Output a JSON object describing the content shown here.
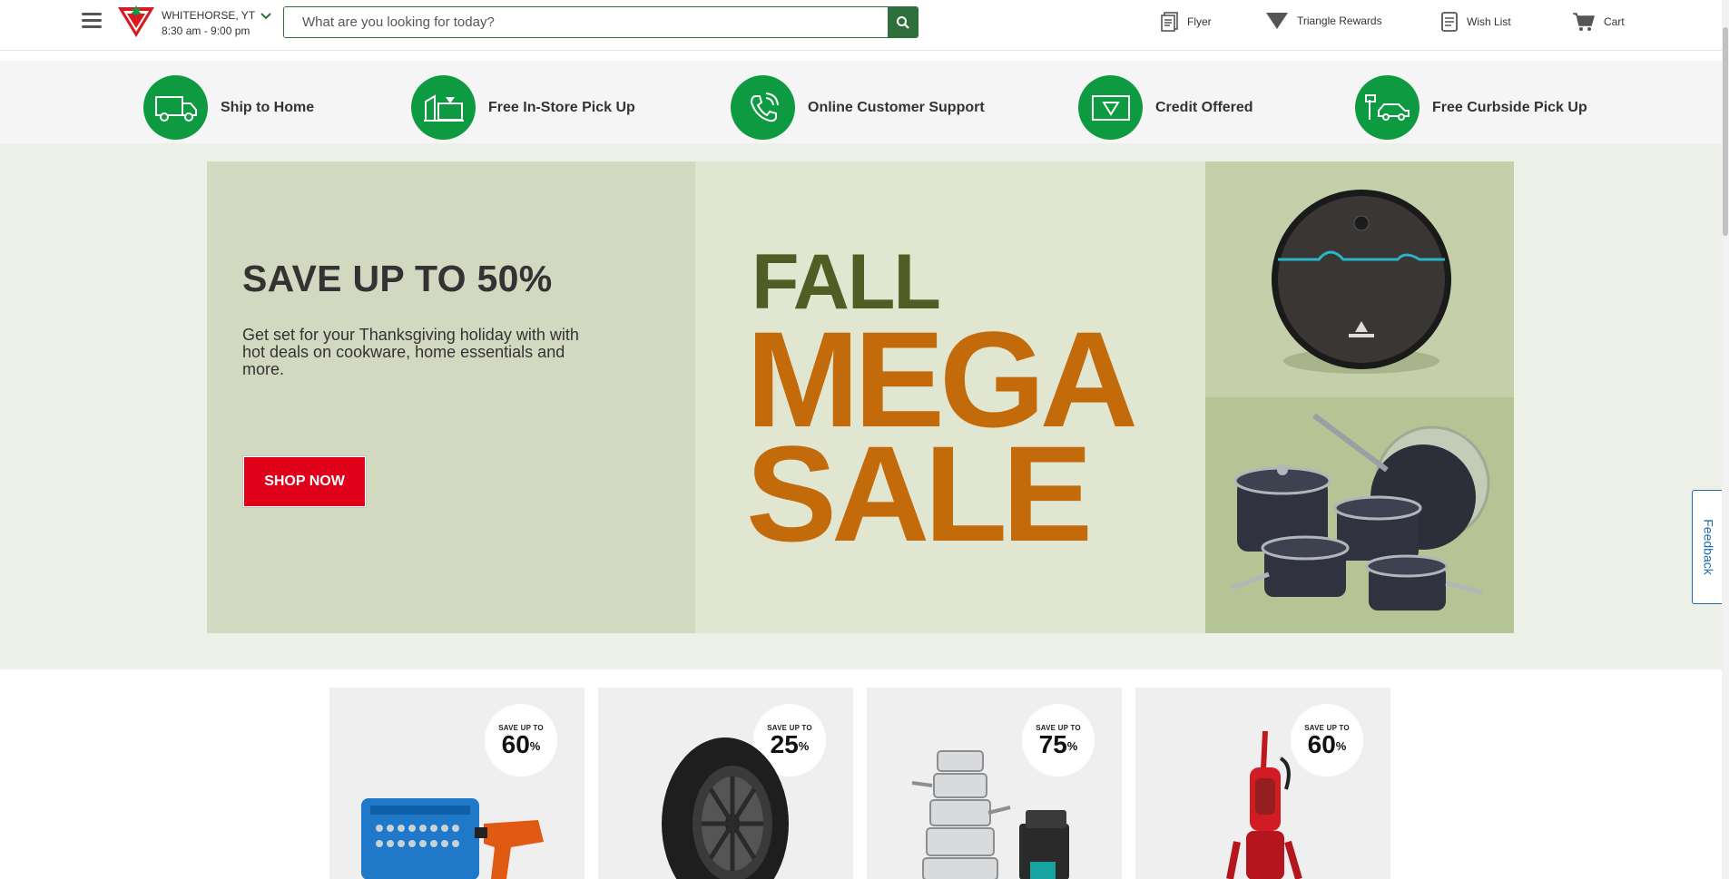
{
  "header": {
    "store_city": "WHITEHORSE, YT",
    "store_hours": "8:30 am - 9:00 pm",
    "search_placeholder": "What are you looking for today?",
    "nav": {
      "flyer": "Flyer",
      "rewards": "Triangle Rewards",
      "wishlist": "Wish List",
      "cart": "Cart"
    }
  },
  "benefits": [
    {
      "label": "Ship to Home",
      "icon": "truck-icon"
    },
    {
      "label": "Free In-Store Pick Up",
      "icon": "store-pickup-icon"
    },
    {
      "label": "Online Customer Support",
      "icon": "phone-icon"
    },
    {
      "label": "Credit Offered",
      "icon": "credit-card-icon"
    },
    {
      "label": "Free Curbside Pick Up",
      "icon": "curbside-car-icon"
    }
  ],
  "hero": {
    "headline": "SAVE UP TO 50%",
    "body": "Get set for your Thanksgiving holiday with with hot deals on cookware, home essentials and more.",
    "cta": "SHOP NOW",
    "sale_word1": "FALL",
    "sale_word2": "MEGA",
    "sale_word3": "SALE"
  },
  "deals": [
    {
      "save_label": "SAVE UP TO",
      "percent": "60",
      "image": "tools-and-drill"
    },
    {
      "save_label": "SAVE UP TO",
      "percent": "25",
      "image": "winter-tire"
    },
    {
      "save_label": "SAVE UP TO",
      "percent": "75",
      "image": "cookware-and-coffee-maker"
    },
    {
      "save_label": "SAVE UP TO",
      "percent": "60",
      "image": "upright-vacuum"
    }
  ],
  "feedback": "Feedback",
  "colors": {
    "brand_green": "#0e9a40",
    "search_green": "#2e6e3a",
    "cta_red": "#e1001a",
    "logo_red": "#d71920",
    "fall_green": "#4e5e24",
    "mega_orange": "#c36a0b"
  }
}
